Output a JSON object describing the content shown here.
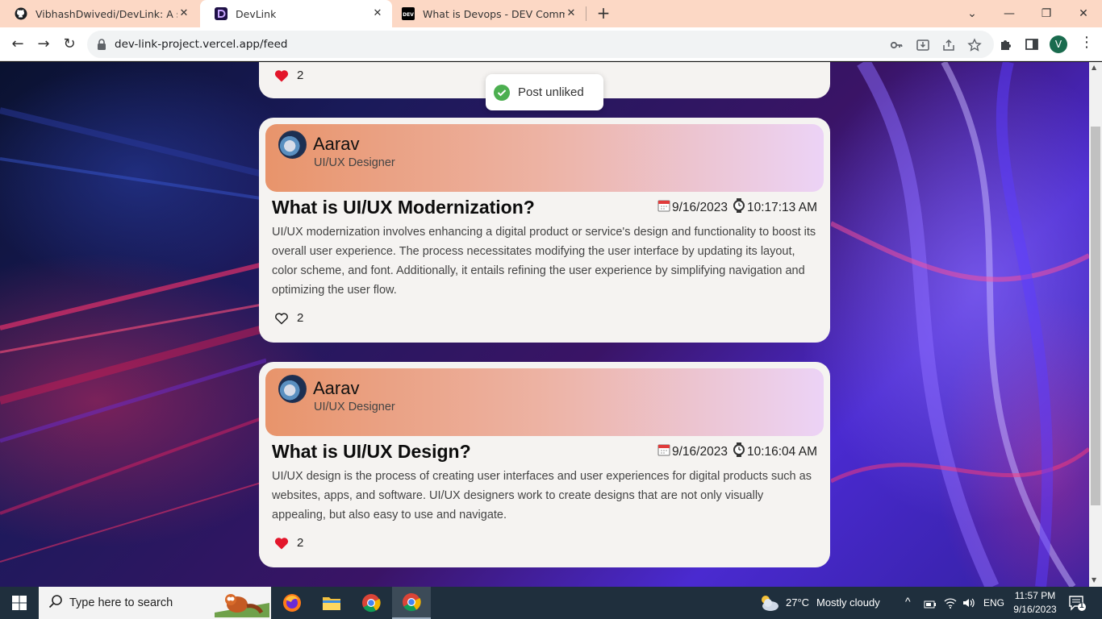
{
  "browser": {
    "tabs": [
      {
        "title": "VibhashDwivedi/DevLink: A socia",
        "icon": "github-icon",
        "active": false
      },
      {
        "title": "DevLink",
        "icon": "devlink-icon",
        "active": true
      },
      {
        "title": "What is Devops - DEV Communit",
        "icon": "dev-icon",
        "active": false
      }
    ],
    "url": "dev-link-project.vercel.app/feed",
    "profile_initial": "V"
  },
  "toast": {
    "message": "Post unliked",
    "icon": "check-circle-icon"
  },
  "feed": {
    "prev_post": {
      "likes": "2",
      "liked": true
    },
    "posts": [
      {
        "author": "Aarav",
        "role": "UI/UX Designer",
        "title": "What is UI/UX Modernization?",
        "date": "9/16/2023",
        "time": "10:17:13 AM",
        "body": "UI/UX modernization involves enhancing a digital product or service's design and functionality to boost its overall user experience. The process necessitates modifying the user interface by updating its layout, color scheme, and font. Additionally, it entails refining the user experience by simplifying navigation and optimizing the user flow.",
        "likes": "2",
        "liked": false
      },
      {
        "author": "Aarav",
        "role": "UI/UX Designer",
        "title": "What is UI/UX Design?",
        "date": "9/16/2023",
        "time": "10:16:04 AM",
        "body": "UI/UX design is the process of creating user interfaces and user experiences for digital products such as websites, apps, and software. UI/UX designers work to create designs that are not only visually appealing, but also easy to use and navigate.",
        "likes": "2",
        "liked": true
      }
    ]
  },
  "taskbar": {
    "search_placeholder": "Type here to search",
    "weather_temp": "27°C",
    "weather_text": "Mostly cloudy",
    "language": "ENG",
    "time": "11:57 PM",
    "date": "9/16/2023",
    "notification_count": "1"
  },
  "colors": {
    "heart": "#e3162b",
    "header_gradient_start": "#e8946b",
    "header_gradient_end": "#ecd3f6",
    "toast_check": "#4caf50",
    "tabbar": "#fcd8c5"
  }
}
